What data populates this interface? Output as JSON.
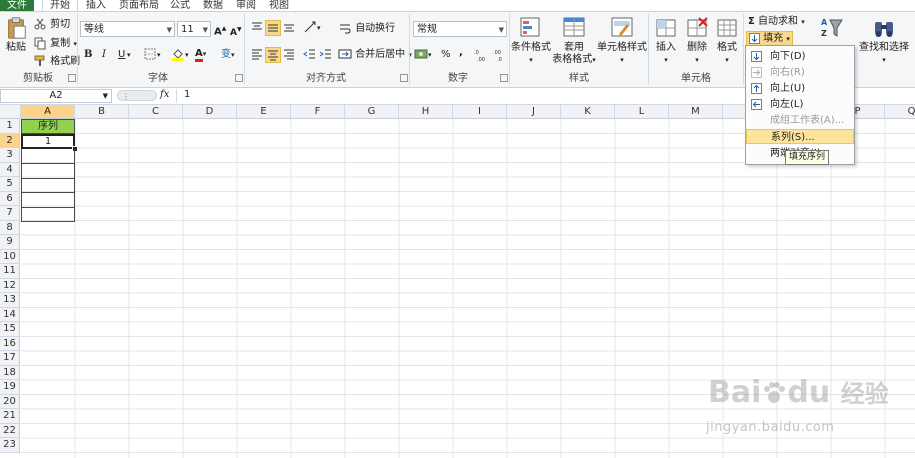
{
  "menubar": {
    "tabs": [
      "文件",
      "开始",
      "插入",
      "页面布局",
      "公式",
      "数据",
      "审阅",
      "视图"
    ],
    "active_tab": "开始"
  },
  "clipboard": {
    "paste": "粘贴",
    "cut": "剪切",
    "copy": "复制",
    "format_painter": "格式刷",
    "group": "剪贴板"
  },
  "font": {
    "name": "等线",
    "size": "11",
    "bold": "B",
    "italic": "I",
    "underline": "U",
    "group": "字体",
    "font_color_glyph": "A",
    "phonetic_glyph": "变"
  },
  "alignment": {
    "wrap": "自动换行",
    "merge": "合并后居中",
    "group": "对齐方式"
  },
  "number": {
    "format": "常规",
    "percent": "%",
    "comma": ",",
    "group": "数字"
  },
  "styles": {
    "conditional": "条件格式",
    "table_line1": "套用",
    "table_line2": "表格格式",
    "cell_styles": "单元格样式",
    "group": "样式"
  },
  "cells": {
    "insert": "插入",
    "delete": "删除",
    "format": "格式",
    "group": "单元格"
  },
  "editing": {
    "autosum": "自动求和",
    "fill": "填充",
    "sort_filter_partial": "排序和筛选",
    "find_select": "查找和选择"
  },
  "formula_bar": {
    "name_box": "A2",
    "fx": "fx",
    "value": "1"
  },
  "grid": {
    "columns": [
      "A",
      "B",
      "C",
      "D",
      "E",
      "F",
      "G",
      "H",
      "I",
      "J",
      "K",
      "L",
      "M",
      "N",
      "O",
      "P",
      "Q"
    ],
    "rows": [
      "1",
      "2",
      "3",
      "4",
      "5",
      "6",
      "7",
      "8",
      "9",
      "10",
      "11",
      "12",
      "13",
      "14",
      "15",
      "16",
      "17",
      "18",
      "19",
      "20",
      "21",
      "22",
      "23"
    ],
    "selected_column": "A",
    "selected_row": "2",
    "a1_header": "序列",
    "a2_value": "1"
  },
  "fill_menu": {
    "items": [
      {
        "label": "向下(D)",
        "enabled": true
      },
      {
        "label": "向右(R)",
        "enabled": false
      },
      {
        "label": "向上(U)",
        "enabled": true
      },
      {
        "label": "向左(L)",
        "enabled": true
      },
      {
        "label": "成组工作表(A)...",
        "enabled": false
      },
      {
        "label": "系列(S)...",
        "enabled": true,
        "highlighted": true
      },
      {
        "label": "两端对齐(J)",
        "enabled": true
      }
    ],
    "tooltip": "填充序列"
  },
  "watermark": {
    "brand": "Bai",
    "brand2": "du",
    "service": "经验",
    "url": "jingyan.baidu.com"
  },
  "colors": {
    "file_tab": "#2b7a3a",
    "header_fill": "#92d050",
    "selection_header": "#fbd38a",
    "menu_highlight": "#fde49a",
    "tooltip_bg": "#ffffe6"
  }
}
